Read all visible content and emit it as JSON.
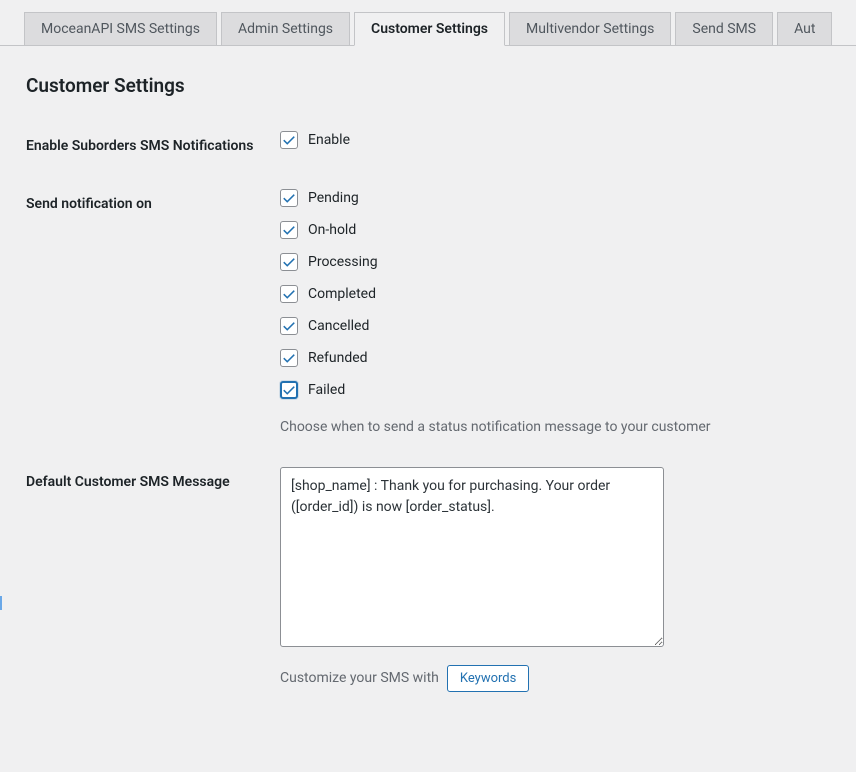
{
  "tabs": {
    "items": [
      {
        "label": "MoceanAPI SMS Settings",
        "active": false
      },
      {
        "label": "Admin Settings",
        "active": false
      },
      {
        "label": "Customer Settings",
        "active": true
      },
      {
        "label": "Multivendor Settings",
        "active": false
      },
      {
        "label": "Send SMS",
        "active": false
      },
      {
        "label": "Aut",
        "active": false
      }
    ]
  },
  "page": {
    "title": "Customer Settings"
  },
  "form": {
    "enable_suborders": {
      "label": "Enable Suborders SMS Notifications",
      "checkbox_label": "Enable",
      "checked": true
    },
    "send_notification": {
      "label": "Send notification on",
      "options": [
        {
          "label": "Pending",
          "checked": true,
          "focus": false
        },
        {
          "label": "On-hold",
          "checked": true,
          "focus": false
        },
        {
          "label": "Processing",
          "checked": true,
          "focus": false
        },
        {
          "label": "Completed",
          "checked": true,
          "focus": false
        },
        {
          "label": "Cancelled",
          "checked": true,
          "focus": false
        },
        {
          "label": "Refunded",
          "checked": true,
          "focus": false
        },
        {
          "label": "Failed",
          "checked": true,
          "focus": true
        }
      ],
      "help_text": "Choose when to send a status notification message to your customer"
    },
    "default_message": {
      "label": "Default Customer SMS Message",
      "value": "[shop_name] : Thank you for purchasing. Your order ([order_id]) is now [order_status].",
      "customize_prefix": "Customize your SMS with",
      "keywords_button": "Keywords"
    }
  }
}
